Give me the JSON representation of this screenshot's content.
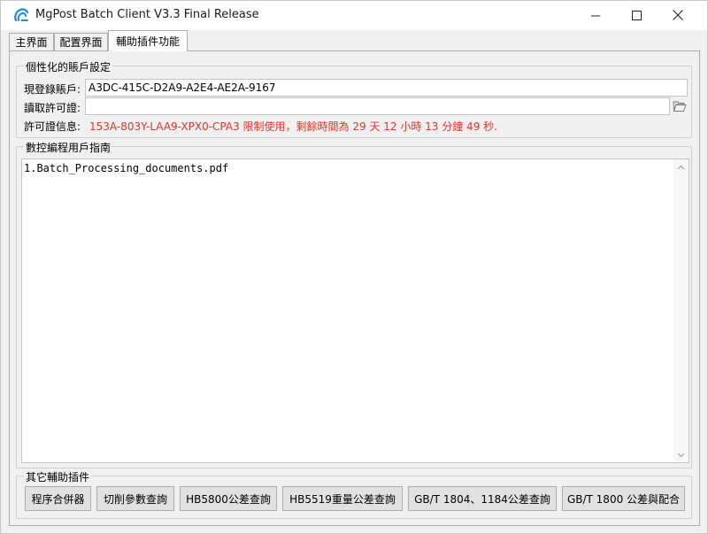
{
  "window": {
    "title": "MgPost Batch Client V3.3 Final Release",
    "controls": {
      "minimize": "—",
      "maximize": "☐",
      "close": "✕"
    }
  },
  "tabs": [
    {
      "label": "主界面",
      "active": false
    },
    {
      "label": "配置界面",
      "active": false
    },
    {
      "label": "輔助插件功能",
      "active": true
    }
  ],
  "account_group": {
    "legend": "個性化的賬戶設定",
    "login_label": "現登錄賬戶:",
    "login_value": "A3DC-415C-D2A9-A2E4-AE2A-9167",
    "read_license_label": "讀取許可證:",
    "read_license_value": "",
    "license_info_label": "許可證信息:",
    "license_info_value": "153A-803Y-LAA9-XPX0-CPA3 限制使用，剩餘時間為 29 天  12 小時  13 分鐘  49 秒.",
    "license_info_color": "#e8322a",
    "browse_icon": "folder-open-icon"
  },
  "guide_group": {
    "legend": "數控編程用戶指南",
    "documents": [
      "1.Batch_Processing_documents.pdf"
    ]
  },
  "plugins_group": {
    "legend": "其它輔助插件",
    "buttons": [
      "程序合併器",
      "切削參數查詢",
      "HB5800公差查詢",
      "HB5519重量公差查詢",
      "GB/T 1804、1184公差查詢",
      "GB/T 1800 公差與配合"
    ]
  },
  "colors": {
    "accent_icon": "#1f8bd8",
    "window_bg": "#f0f0f0",
    "error_text": "#e8322a"
  }
}
